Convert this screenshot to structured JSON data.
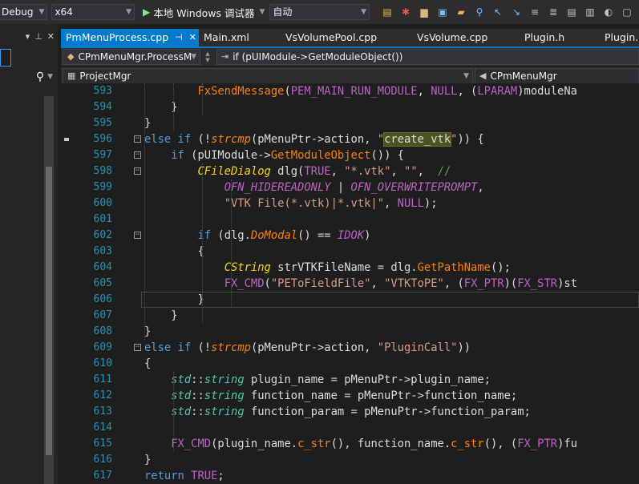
{
  "toolbar": {
    "config": "Debug",
    "platform": "x64",
    "run_label": "本地 Windows 调试器",
    "run_mode": "自动",
    "icons": [
      "find-in-files-icon",
      "build-icon",
      "open-folder-icon",
      "save-icon",
      "bookmark-icon",
      "search-icon",
      "navigate-back-icon",
      "navigate-forward-icon",
      "comment-icon",
      "uncomment-icon",
      "prev-bookmark-icon",
      "next-bookmark-icon",
      "settings-icon",
      "window-icon"
    ]
  },
  "tabs": [
    {
      "label": "PmMenuProcess.cpp",
      "active": true
    },
    {
      "label": "Main.xml"
    },
    {
      "label": "VsVolumePool.cpp"
    },
    {
      "label": "VsVolume.cpp"
    },
    {
      "label": "Plugin.h"
    },
    {
      "label": "Plugin.cpp"
    }
  ],
  "nav": {
    "scope": "CPmMenuMgr.ProcessM",
    "member": "if (pUIModule->GetModuleObject())"
  },
  "projbar": {
    "project": "ProjectMgr",
    "class": "CPmMenuMgr"
  },
  "colors": {
    "accent": "#007acc",
    "background": "#1e1e1e",
    "line_number": "#2b91af"
  },
  "lines": [
    {
      "n": "593",
      "segs": [
        [
          "        "
        ],
        [
          "FxSendMessage",
          "fnp"
        ],
        [
          "("
        ],
        [
          "PEM_MAIN_RUN_MODULE",
          "mac"
        ],
        [
          ", "
        ],
        [
          "NULL",
          "mac"
        ],
        [
          ", ("
        ],
        [
          "LPARAM",
          "mac"
        ],
        [
          ")moduleNa"
        ]
      ]
    },
    {
      "n": "594",
      "segs": [
        [
          "    }"
        ]
      ]
    },
    {
      "n": "595",
      "segs": [
        [
          "}"
        ]
      ]
    },
    {
      "n": "596",
      "fold": true,
      "segs": [
        [
          "else",
          "kw"
        ],
        [
          " "
        ],
        [
          "if",
          "kw"
        ],
        [
          " (!"
        ],
        [
          "strcmp",
          "fni"
        ],
        [
          "(pMenuPtr->action, "
        ],
        [
          "\"",
          "str"
        ],
        [
          "create_vtk",
          "hl"
        ],
        [
          "\"",
          "str"
        ],
        [
          ")) {"
        ]
      ]
    },
    {
      "n": "597",
      "fold": true,
      "segs": [
        [
          "    "
        ],
        [
          "if",
          "kw"
        ],
        [
          " (pUIModule->"
        ],
        [
          "GetModuleObject",
          "fnp"
        ],
        [
          "()) {"
        ]
      ]
    },
    {
      "n": "598",
      "fold": true,
      "segs": [
        [
          "        "
        ],
        [
          "CFileDialog",
          "clsi"
        ],
        [
          " dlg("
        ],
        [
          "TRUE",
          "mac"
        ],
        [
          ", "
        ],
        [
          "\"*.vtk\"",
          "str"
        ],
        [
          ", "
        ],
        [
          "\"\"",
          "str"
        ],
        [
          ",  "
        ],
        [
          "//",
          "cmt"
        ]
      ]
    },
    {
      "n": "599",
      "segs": [
        [
          "            "
        ],
        [
          "OFN_HIDEREADONLY",
          "maci"
        ],
        [
          " | "
        ],
        [
          "OFN_OVERWRITEPROMPT",
          "maci"
        ],
        [
          ","
        ]
      ]
    },
    {
      "n": "600",
      "segs": [
        [
          "            "
        ],
        [
          "\"VTK File(*.vtk)|*.vtk|\"",
          "str"
        ],
        [
          ", "
        ],
        [
          "NULL",
          "mac"
        ],
        [
          ");"
        ]
      ]
    },
    {
      "n": "601",
      "segs": [
        [
          ""
        ]
      ]
    },
    {
      "n": "602",
      "fold": true,
      "segs": [
        [
          "        "
        ],
        [
          "if",
          "kw"
        ],
        [
          " (dlg."
        ],
        [
          "DoModal",
          "fni"
        ],
        [
          "() == "
        ],
        [
          "IDOK",
          "maci"
        ],
        [
          ")"
        ]
      ]
    },
    {
      "n": "603",
      "segs": [
        [
          "        {"
        ]
      ]
    },
    {
      "n": "604",
      "segs": [
        [
          "            "
        ],
        [
          "CString",
          "clsi"
        ],
        [
          " strVTKFileName = dlg."
        ],
        [
          "GetPathName",
          "fnp"
        ],
        [
          "();"
        ]
      ]
    },
    {
      "n": "605",
      "segs": [
        [
          "            "
        ],
        [
          "FX_CMD",
          "mac"
        ],
        [
          "("
        ],
        [
          "\"PEToFieldFile\"",
          "str"
        ],
        [
          ", "
        ],
        [
          "\"VTKToPE\"",
          "str"
        ],
        [
          ", ("
        ],
        [
          "FX_PTR",
          "mac"
        ],
        [
          ")("
        ],
        [
          "FX_STR",
          "mac"
        ],
        [
          ")st"
        ]
      ]
    },
    {
      "n": "606",
      "segs": [
        [
          "        }"
        ]
      ]
    },
    {
      "n": "607",
      "segs": [
        [
          "    }"
        ]
      ]
    },
    {
      "n": "608",
      "segs": [
        [
          "}"
        ]
      ]
    },
    {
      "n": "609",
      "fold": true,
      "segs": [
        [
          "else",
          "kw"
        ],
        [
          " "
        ],
        [
          "if",
          "kw"
        ],
        [
          " (!"
        ],
        [
          "strcmp",
          "fni"
        ],
        [
          "(pMenuPtr->action, "
        ],
        [
          "\"PluginCall\"",
          "str"
        ],
        [
          "))"
        ]
      ]
    },
    {
      "n": "610",
      "segs": [
        [
          "{"
        ]
      ]
    },
    {
      "n": "611",
      "segs": [
        [
          "    "
        ],
        [
          "std",
          "ns"
        ],
        [
          "::"
        ],
        [
          "string",
          "ns"
        ],
        [
          " plugin_name = pMenuPtr->plugin_name;"
        ]
      ]
    },
    {
      "n": "612",
      "segs": [
        [
          "    "
        ],
        [
          "std",
          "ns"
        ],
        [
          "::"
        ],
        [
          "string",
          "ns"
        ],
        [
          " function_name = pMenuPtr->function_name;"
        ]
      ]
    },
    {
      "n": "613",
      "segs": [
        [
          "    "
        ],
        [
          "std",
          "ns"
        ],
        [
          "::"
        ],
        [
          "string",
          "ns"
        ],
        [
          " function_param = pMenuPtr->function_param;"
        ]
      ]
    },
    {
      "n": "614",
      "segs": [
        [
          ""
        ]
      ]
    },
    {
      "n": "615",
      "segs": [
        [
          "    "
        ],
        [
          "FX_CMD",
          "mac"
        ],
        [
          "(plugin_name."
        ],
        [
          "c_str",
          "fnp"
        ],
        [
          "(), function_name."
        ],
        [
          "c_str",
          "fnp"
        ],
        [
          "(), ("
        ],
        [
          "FX_PTR",
          "mac"
        ],
        [
          ")fu"
        ]
      ]
    },
    {
      "n": "616",
      "segs": [
        [
          "}"
        ]
      ]
    },
    {
      "n": "617",
      "segs": [
        [
          "return",
          "kw"
        ],
        [
          " "
        ],
        [
          "TRUE",
          "mac"
        ],
        [
          ";"
        ]
      ]
    }
  ]
}
